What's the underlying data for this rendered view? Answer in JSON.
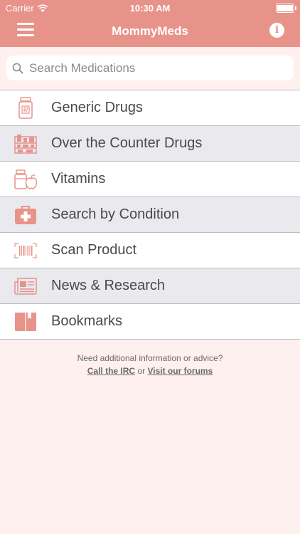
{
  "status_bar": {
    "carrier": "Carrier",
    "time": "10:30 AM"
  },
  "navbar": {
    "title": "MommyMeds",
    "info_glyph": "i"
  },
  "search": {
    "placeholder": "Search Medications",
    "value": ""
  },
  "menu": {
    "items": [
      {
        "label": "Generic Drugs",
        "icon": "pill-bottle-icon"
      },
      {
        "label": "Over the Counter Drugs",
        "icon": "pharmacy-shelf-icon"
      },
      {
        "label": "Vitamins",
        "icon": "vitamins-apple-icon"
      },
      {
        "label": "Search by Condition",
        "icon": "first-aid-kit-icon"
      },
      {
        "label": "Scan Product",
        "icon": "barcode-icon"
      },
      {
        "label": "News & Research",
        "icon": "newspaper-icon"
      },
      {
        "label": "Bookmarks",
        "icon": "book-bookmark-icon"
      }
    ]
  },
  "footer": {
    "prompt": "Need additional information or advice?",
    "link_irc": "Call the IRC",
    "separator": "or",
    "link_forums": "Visit our forums"
  },
  "colors": {
    "header": "#e8938a",
    "accent": "#e8938a",
    "background": "#fdf0ef",
    "row_alt": "#e9e9ee"
  }
}
